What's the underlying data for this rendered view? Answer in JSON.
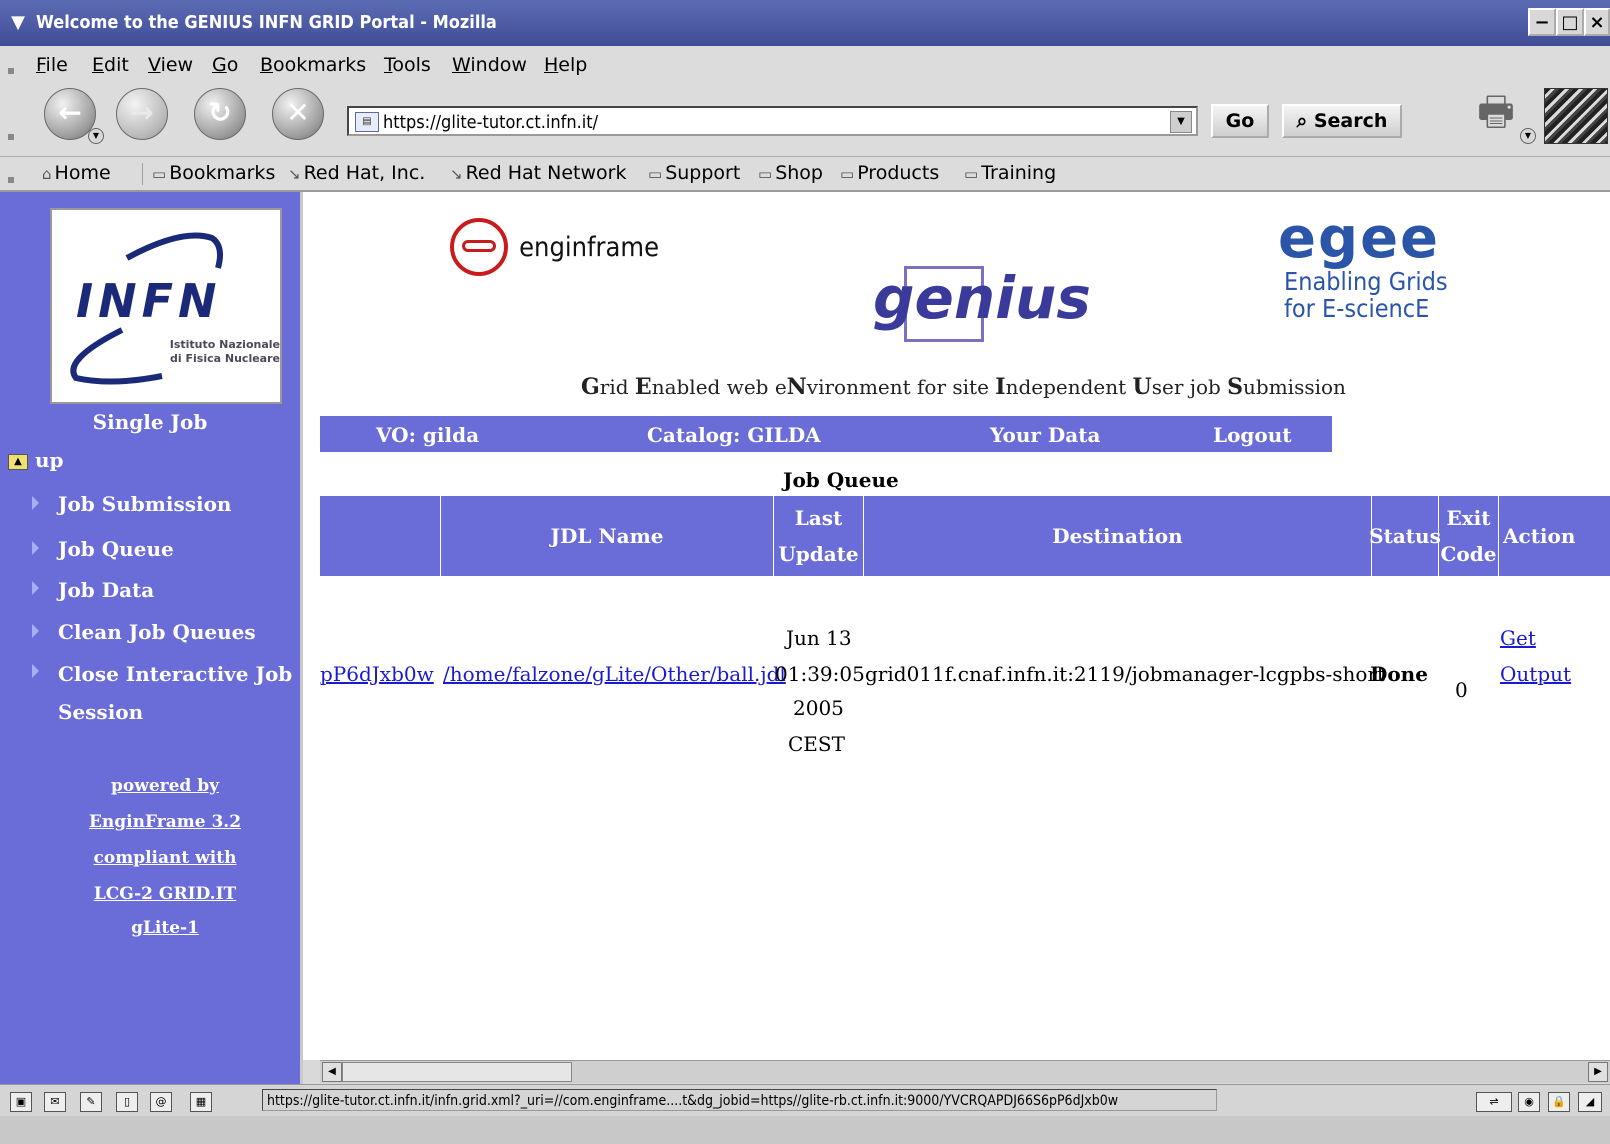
{
  "window": {
    "title": "Welcome to the GENIUS INFN GRID Portal - Mozilla",
    "minimize": "−",
    "maximize": "□",
    "close": "×"
  },
  "menu": [
    "File",
    "Edit",
    "View",
    "Go",
    "Bookmarks",
    "Tools",
    "Window",
    "Help"
  ],
  "nav": {
    "url": "https://glite-tutor.ct.infn.it/",
    "go_label": "Go",
    "search_label": "Search"
  },
  "personal_toolbar": [
    "Home",
    "Bookmarks",
    "Red Hat, Inc.",
    "Red Hat Network",
    "Support",
    "Shop",
    "Products",
    "Training"
  ],
  "sidebar": {
    "logo_text": "INFN",
    "logo_sub1": "Istituto Nazionale",
    "logo_sub2": "di Fisica Nucleare",
    "section_title": "Single Job",
    "up_label": "up",
    "items": [
      "Job Submission",
      "Job Queue",
      "Job Data",
      "Clean Job Queues",
      "Close Interactive Job",
      "Session"
    ],
    "powered": [
      "powered by",
      "EnginFrame 3.2",
      "compliant with",
      "LCG-2 GRID.IT",
      "gLite-1"
    ]
  },
  "header": {
    "enginframe": "enginframe",
    "genius": "genius",
    "egee_word": "egee",
    "egee_line1": "Enabling Grids",
    "egee_line2": "for E-sciencE",
    "tagline_parts": [
      "G",
      "rid ",
      "E",
      "nabled web e",
      "N",
      "vironment for site ",
      "I",
      "ndependent ",
      "U",
      "ser job ",
      "S",
      "ubmission"
    ]
  },
  "vobar": {
    "vo": "VO: gilda",
    "catalog": "Catalog: GILDA",
    "your_data": "Your Data",
    "logout": "Logout"
  },
  "queue": {
    "title": "Job Queue",
    "columns": {
      "jdl_name": "JDL Name",
      "last": "Last",
      "update": "Update",
      "destination": "Destination",
      "status": "Status",
      "exit": "Exit",
      "code": "Code",
      "action": "Action"
    },
    "row": {
      "job_id": "pP6dJxb0w",
      "jdl": "/home/falzone/gLite/Other/ball.jdl",
      "update_lines": [
        "Jun 13",
        "01:39:05",
        "2005",
        "CEST"
      ],
      "destination": "grid011f.cnaf.infn.it:2119/jobmanager-lcgpbs-short",
      "status": "Done",
      "exit_code": "0",
      "action_lines": [
        "Get",
        "Output"
      ]
    }
  },
  "statusbar": {
    "text": "https://glite-tutor.ct.infn.it/infn.grid.xml?_uri=//com.enginframe....t&dg_jobid=https//glite-rb.ct.infn.it:9000/YVCRQAPDJ66S6pP6dJxb0w"
  }
}
